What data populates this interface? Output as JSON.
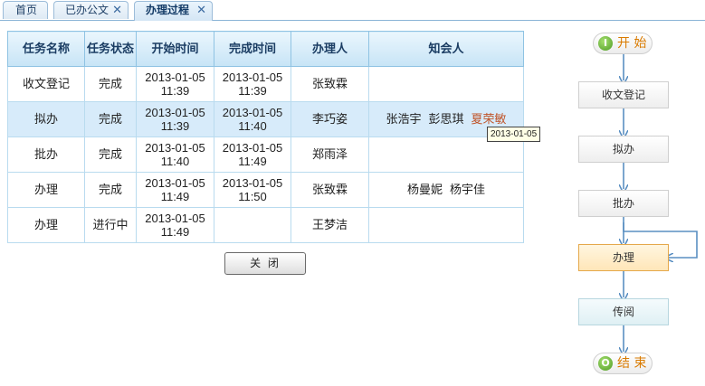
{
  "tabs": [
    {
      "label": "首页",
      "closable": false,
      "active": false
    },
    {
      "label": "已办公文",
      "closable": true,
      "active": false
    },
    {
      "label": "办理过程",
      "closable": true,
      "active": true
    }
  ],
  "table": {
    "headers": {
      "task_name": "任务名称",
      "task_status": "任务状态",
      "start_time": "开始时间",
      "end_time": "完成时间",
      "handler": "办理人",
      "cc": "知会人"
    },
    "rows": [
      {
        "name": "收文登记",
        "status": "完成",
        "start_date": "2013-01-05",
        "start_time": "11:39",
        "end_date": "2013-01-05",
        "end_time": "11:39",
        "handler": "张致霖",
        "cc": []
      },
      {
        "name": "拟办",
        "status": "完成",
        "start_date": "2013-01-05",
        "start_time": "11:39",
        "end_date": "2013-01-05",
        "end_time": "11:40",
        "handler": "李巧姿",
        "cc": [
          "张浩宇",
          "彭思琪",
          "夏荣敏"
        ]
      },
      {
        "name": "批办",
        "status": "完成",
        "start_date": "2013-01-05",
        "start_time": "11:40",
        "end_date": "2013-01-05",
        "end_time": "11:49",
        "handler": "郑雨泽",
        "cc": []
      },
      {
        "name": "办理",
        "status": "完成",
        "start_date": "2013-01-05",
        "start_time": "11:49",
        "end_date": "2013-01-05",
        "end_time": "11:50",
        "handler": "张致霖",
        "cc": [
          "杨曼妮",
          "杨宇佳"
        ]
      },
      {
        "name": "办理",
        "status": "进行中",
        "start_date": "2013-01-05",
        "start_time": "11:49",
        "end_date": "",
        "end_time": "",
        "handler": "王梦洁",
        "cc": []
      }
    ]
  },
  "tooltip": "2013-01-05",
  "close_button": "关 闭",
  "flow": {
    "start": "开 始",
    "end": "结 束",
    "start_icon": "I",
    "end_icon": "O",
    "nodes": [
      "收文登记",
      "拟办",
      "批办",
      "办理",
      "传阅"
    ],
    "current_node": "办理",
    "colors": {
      "arrow": "#5a8fc2",
      "current": "#ffe6b8",
      "pill_text": "#d97a00"
    }
  }
}
